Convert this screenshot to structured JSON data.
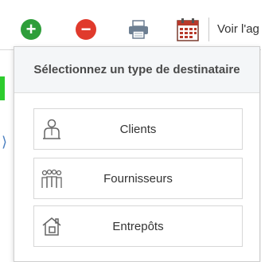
{
  "toolbar": {
    "add_icon": "plus-circle-icon",
    "remove_icon": "minus-circle-icon",
    "print_icon": "printer-icon",
    "calendar_icon": "calendar-icon",
    "agenda_label": "Voir l'ag",
    "colors": {
      "add": "#2e9e3a",
      "remove": "#e03a2c"
    }
  },
  "panel": {
    "title": "Sélectionnez un type de destinataire",
    "options": [
      {
        "label": "Clients",
        "icon": "person-icon"
      },
      {
        "label": "Fournisseurs",
        "icon": "group-icon"
      },
      {
        "label": "Entrepôts",
        "icon": "house-icon"
      }
    ]
  }
}
